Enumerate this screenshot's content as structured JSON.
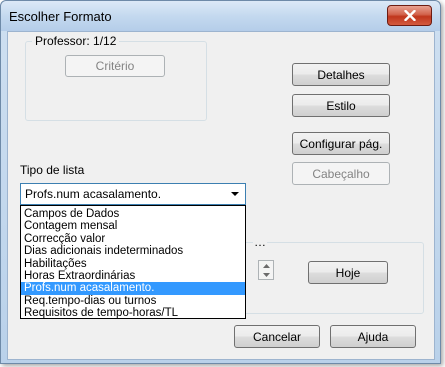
{
  "window": {
    "title": "Escolher Formato"
  },
  "professor_group": {
    "label": "Professor: 1/12",
    "criteria_button": "Critério"
  },
  "buttons": {
    "details": "Detalhes",
    "style": "Estilo",
    "page_setup": "Configurar pág.",
    "header": "Cabeçalho",
    "today": "Hoje",
    "cancel": "Cancelar",
    "help": "Ajuda"
  },
  "list_type": {
    "label": "Tipo de lista",
    "selected_value": "Profs.num acasalamento.",
    "options": [
      "Campos de Dados",
      "Contagem mensal",
      "Correcção valor",
      "Dias adicionais indeterminados",
      "Habilitações",
      "Horas Extraordinárias",
      "Profs.num acasalamento.",
      "Req.tempo-dias ou turnos",
      "Requisitos de tempo-horas/TL"
    ],
    "selected_index": 6
  },
  "colors": {
    "selection": "#3399ff",
    "close_button": "#c0361d"
  },
  "icons": {
    "close": "close-icon",
    "dropdown": "chevron-down-icon",
    "spin_up": "spin-up-icon",
    "spin_down": "spin-down-icon"
  }
}
